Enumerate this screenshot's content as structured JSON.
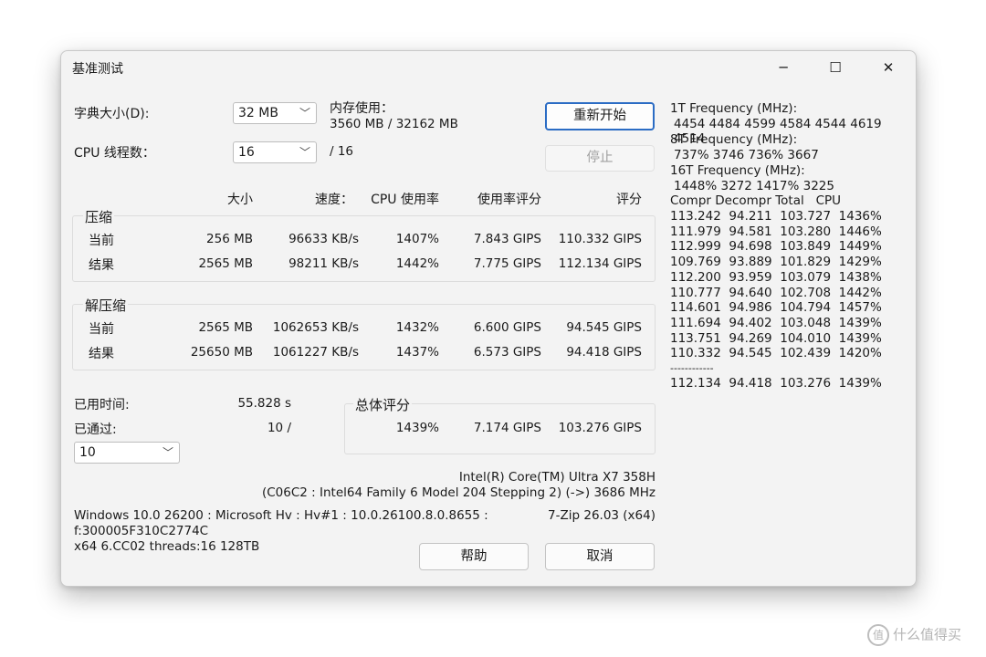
{
  "window": {
    "title": "基准测试",
    "minimize_icon": "─",
    "maximize_icon": "☐",
    "close_icon": "✕"
  },
  "dict_size": {
    "label": "字典大小(D):",
    "value": "32 MB"
  },
  "memory": {
    "label": "内存使用：",
    "value": "3560 MB / 32162 MB"
  },
  "threads": {
    "label": "CPU 线程数：",
    "value": "16",
    "max": "/ 16"
  },
  "buttons": {
    "restart": "重新开始",
    "stop": "停止",
    "help": "帮助",
    "cancel": "取消"
  },
  "columns": {
    "size": "大小",
    "speed": "速度：",
    "cpu_usage": "CPU 使用率",
    "rating_per_usage": "使用率评分",
    "rating": "评分"
  },
  "compress": {
    "title": "压缩",
    "rows": [
      {
        "label": "当前",
        "size": "256 MB",
        "speed": "96633 KB/s",
        "usage": "1407%",
        "rpu": "7.843 GIPS",
        "rating": "110.332 GIPS"
      },
      {
        "label": "结果",
        "size": "2565 MB",
        "speed": "98211 KB/s",
        "usage": "1442%",
        "rpu": "7.775 GIPS",
        "rating": "112.134 GIPS"
      }
    ]
  },
  "decompress": {
    "title": "解压缩",
    "rows": [
      {
        "label": "当前",
        "size": "2565 MB",
        "speed": "1062653 KB/s",
        "usage": "1432%",
        "rpu": "6.600 GIPS",
        "rating": "94.545 GIPS"
      },
      {
        "label": "结果",
        "size": "25650 MB",
        "speed": "1061227 KB/s",
        "usage": "1437%",
        "rpu": "6.573 GIPS",
        "rating": "94.418 GIPS"
      }
    ]
  },
  "elapsed": {
    "label": "已用时间:",
    "value": "55.828 s"
  },
  "passes": {
    "label": "已通过:",
    "value": "10 /",
    "select": "10"
  },
  "total": {
    "title": "总体评分",
    "usage": "1439%",
    "rpu": "7.174 GIPS",
    "rating": "103.276 GIPS"
  },
  "cpu_info": {
    "line1": "Intel(R) Core(TM) Ultra X7 358H",
    "line2": "(C06C2 : Intel64 Family 6 Model 204 Stepping 2) (->) 3686 MHz"
  },
  "sys_info": {
    "line1": "Windows 10.0 26200 : Microsoft Hv : Hv#1 : 10.0.26100.8.0.8655 :",
    "line2": "f:300005F310C2774C",
    "line3": "x64 6.CC02 threads:16 128TB",
    "version": "7-Zip 26.03 (x64)"
  },
  "frequency": {
    "t1_label": "1T Frequency (MHz):",
    "t1_values": "4454 4484 4599 4584 4544 4619 4514",
    "t8_label": "8T Frequency (MHz):",
    "t8_values": "737% 3746 736% 3667",
    "t16_label": "16T Frequency (MHz):",
    "t16_values": "1448% 3272 1417% 3225"
  },
  "history": {
    "header": "Compr Decompr Total   CPU",
    "rows": [
      "113.242  94.211  103.727  1436%",
      "111.979  94.581  103.280  1446%",
      "112.999  94.698  103.849  1449%",
      "109.769  93.889  101.829  1429%",
      "112.200  93.959  103.079  1438%",
      "110.777  94.640  102.708  1442%",
      "114.601  94.986  104.794  1457%",
      "111.694  94.402  103.048  1439%",
      "113.751  94.269  104.010  1439%",
      "110.332  94.545  102.439  1420%"
    ],
    "separator": "------------",
    "total": "112.134  94.418  103.276  1439%"
  },
  "watermark": {
    "icon": "值",
    "text": "什么值得买"
  }
}
